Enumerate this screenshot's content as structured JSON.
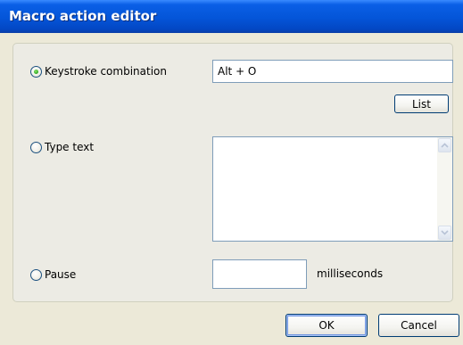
{
  "window": {
    "title": "Macro action editor"
  },
  "options": {
    "keystroke": {
      "label": "Keystroke combination",
      "selected": true,
      "value": "Alt + O"
    },
    "list_button": "List",
    "type_text": {
      "label": "Type text",
      "selected": false,
      "value": ""
    },
    "pause": {
      "label": "Pause",
      "selected": false,
      "value": "",
      "unit": "milliseconds"
    }
  },
  "footer": {
    "ok_label": "OK",
    "cancel_label": "Cancel"
  },
  "colors": {
    "title_bar": "#0455d8",
    "dialog_bg": "#ece9d8",
    "radio_selected": "#38b02a"
  },
  "icons": {
    "scroll_up": "chevron-up-icon",
    "scroll_down": "chevron-down-icon"
  }
}
